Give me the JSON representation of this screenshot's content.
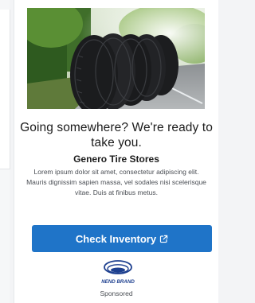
{
  "ad": {
    "headline": "Going somewhere? We're ready to take you.",
    "brand_name": "Genero Tire Stores",
    "body": "Lorem ipsum dolor sit amet, consectetur adipiscing elit. Mauris dignissim sapien massa, vel sodales nisi scelerisque vitae. Duis at finibus metus.",
    "cta_label": "Check Inventory",
    "cta_icon": "external-link-icon",
    "logo_text": "NEND BRAND",
    "sponsored_label": "Sponsored",
    "hero_image": "tires-stack-photo",
    "colors": {
      "cta_background": "#1f74c8",
      "logo_blue": "#1d3f8f",
      "headline": "#1b1b1b"
    }
  }
}
